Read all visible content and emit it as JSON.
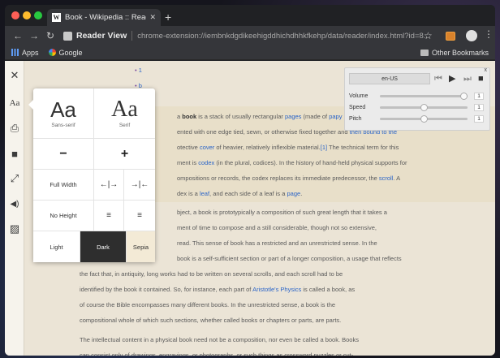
{
  "window": {
    "tab_title": "Book - Wikipedia :: Reader View",
    "tab_favicon": "W",
    "tab_close": "✕",
    "new_tab": "+"
  },
  "toolbar": {
    "back": "←",
    "forward": "→",
    "reload": "↻",
    "site_label": "Reader View",
    "url": "chrome-extension://iembnkdgdikeehigddhichdhhkfkehp/data/reader/index.html?id=8...",
    "star": "☆",
    "menu": "⋮"
  },
  "bookmarks": {
    "apps": "Apps",
    "google": "Google",
    "other": "Other Bookmarks"
  },
  "left_bar": {
    "close": "✕",
    "fonts": "Aa",
    "print": "⎙",
    "save": "■",
    "fullscreen": "⤢",
    "speech": "◀)",
    "images": "▨"
  },
  "popup": {
    "sans_glyph": "Aa",
    "sans_label": "Sans-serif",
    "serif_glyph": "Aa",
    "serif_label": "Serif",
    "decrease": "−",
    "increase": "+",
    "full_width": "Full Width",
    "widen": "←|→",
    "narrow": "→|←",
    "line_height": "No Height",
    "align_left": "≡",
    "align_right": "≡",
    "theme_light": "Light",
    "theme_dark": "Dark",
    "theme_sepia": "Sepia"
  },
  "tts": {
    "language": "en-US",
    "prev": "⏮",
    "play": "▶",
    "next": "⏭",
    "stop": "■",
    "close": "x",
    "volume_label": "Volume",
    "volume_value": "1",
    "speed_label": "Speed",
    "speed_value": "1",
    "pitch_label": "Pitch",
    "pitch_value": "1",
    "volume_level": 1.0,
    "speed_level": 0.5,
    "pitch_level": 0.5
  },
  "article": {
    "bullet1": "1",
    "bullet2": "b",
    "p1_pre": "a ",
    "p1_book": "book",
    "p1_a": " is a stack of usually rectangular ",
    "p1_pages": "pages",
    "p1_b": " (made of ",
    "p1_papy": "papy",
    "l2_a": "ented with one edge tied, sewn, or otherwise fixed together and ",
    "l2_link": "then bound to the",
    "l3_a": "otective ",
    "l3_cover": "cover",
    "l3_b": " of heavier, relatively inflexible material.",
    "l3_ref": "[1]",
    "l3_c": " The technical term for this",
    "l4_a": "ment is ",
    "l4_codex": "codex",
    "l4_b": " (in the plural, codices). In the history of hand-held physical supports for",
    "l5_a": "ompositions or records, the codex replaces its immediate predecessor, the ",
    "l5_scroll": "scroll",
    "l5_b": ". A",
    "l6_a": "dex is a ",
    "l6_leaf": "leaf",
    "l6_b": ", and each side of a leaf is a ",
    "l6_page": "page",
    "l6_c": ".",
    "l8": "bject, a book is prototypically a composition of such great length that it takes a",
    "l9": "ment of time to compose and a still considerable, though not so extensive,",
    "l10": "read. This sense of book has a restricted and an unrestricted sense. In the",
    "l11": "book is a self-sufficient section or part of a longer composition, a usage that reflects",
    "l12": "the fact that, in antiquity, long works had to be written on several scrolls, and each scroll had to be",
    "l13_a": "identified by the book it contained. So, for instance, each part of ",
    "l13_link": "Aristotle's Physics",
    "l13_b": " is called a book, as",
    "l14": "of course the Bible encompasses many different books. In the unrestricted sense, a book is the",
    "l15": "compositional whole of which such sections, whether called books or chapters or parts, are parts.",
    "l16": "The intellectual content in a physical book need not be a composition, nor even be called a book. Books",
    "l17": "can consist only of drawings, engravings, or photographs, or such things as crossword puzzles or cut-"
  }
}
